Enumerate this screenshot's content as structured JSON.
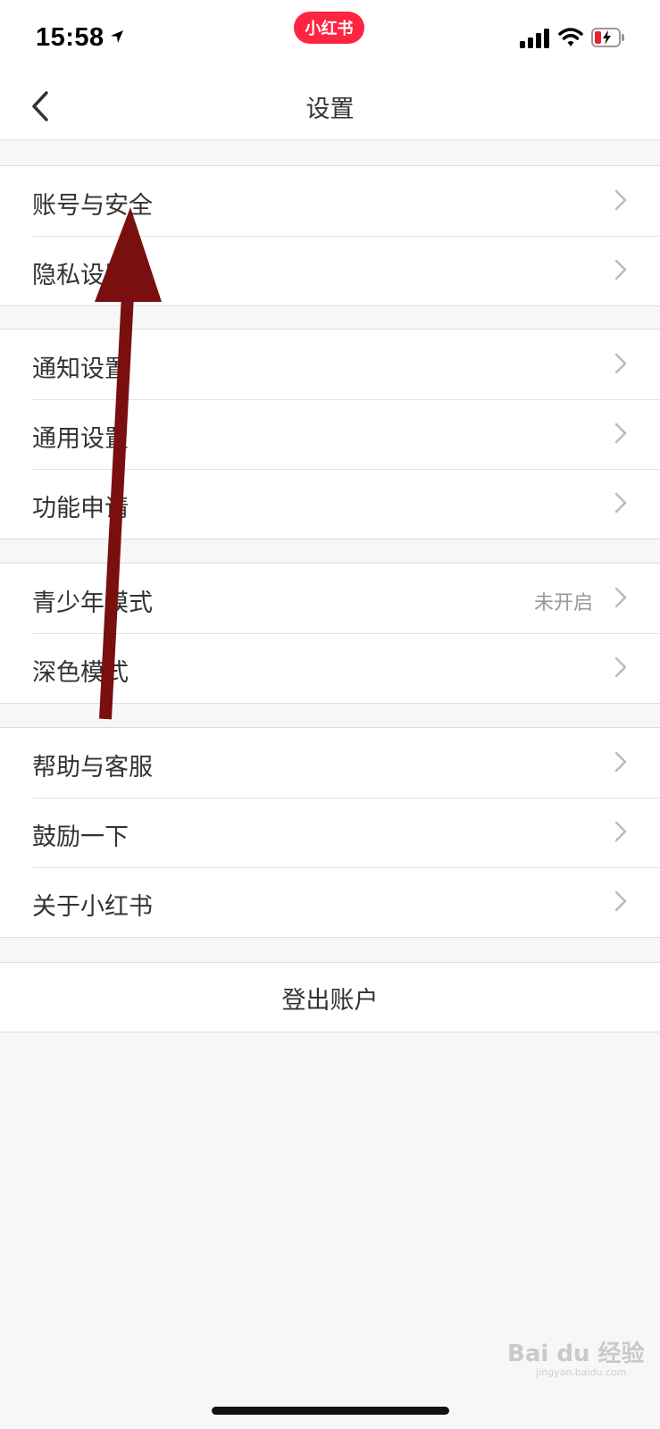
{
  "status_bar": {
    "time": "15:58",
    "app_badge": "小红书"
  },
  "nav": {
    "title": "设置"
  },
  "groups": [
    {
      "items": [
        {
          "label": "账号与安全",
          "value": ""
        },
        {
          "label": "隐私设置",
          "value": ""
        }
      ]
    },
    {
      "items": [
        {
          "label": "通知设置",
          "value": ""
        },
        {
          "label": "通用设置",
          "value": ""
        },
        {
          "label": "功能申请",
          "value": ""
        }
      ]
    },
    {
      "items": [
        {
          "label": "青少年模式",
          "value": "未开启"
        },
        {
          "label": "深色模式",
          "value": ""
        }
      ]
    },
    {
      "items": [
        {
          "label": "帮助与客服",
          "value": ""
        },
        {
          "label": "鼓励一下",
          "value": ""
        },
        {
          "label": "关于小红书",
          "value": ""
        }
      ]
    }
  ],
  "logout": {
    "label": "登出账户"
  },
  "watermark": {
    "brand": "Bai du 经验",
    "url": "jingyan.baidu.com"
  },
  "colors": {
    "brand": "#ff2442",
    "annotation_arrow": "#7a0f0f",
    "background": "#f7f7f7"
  },
  "icons": [
    "location-arrow-icon",
    "cellular-signal-icon",
    "wifi-icon",
    "battery-charging-icon",
    "back-chevron-icon",
    "chevron-right-icon"
  ]
}
